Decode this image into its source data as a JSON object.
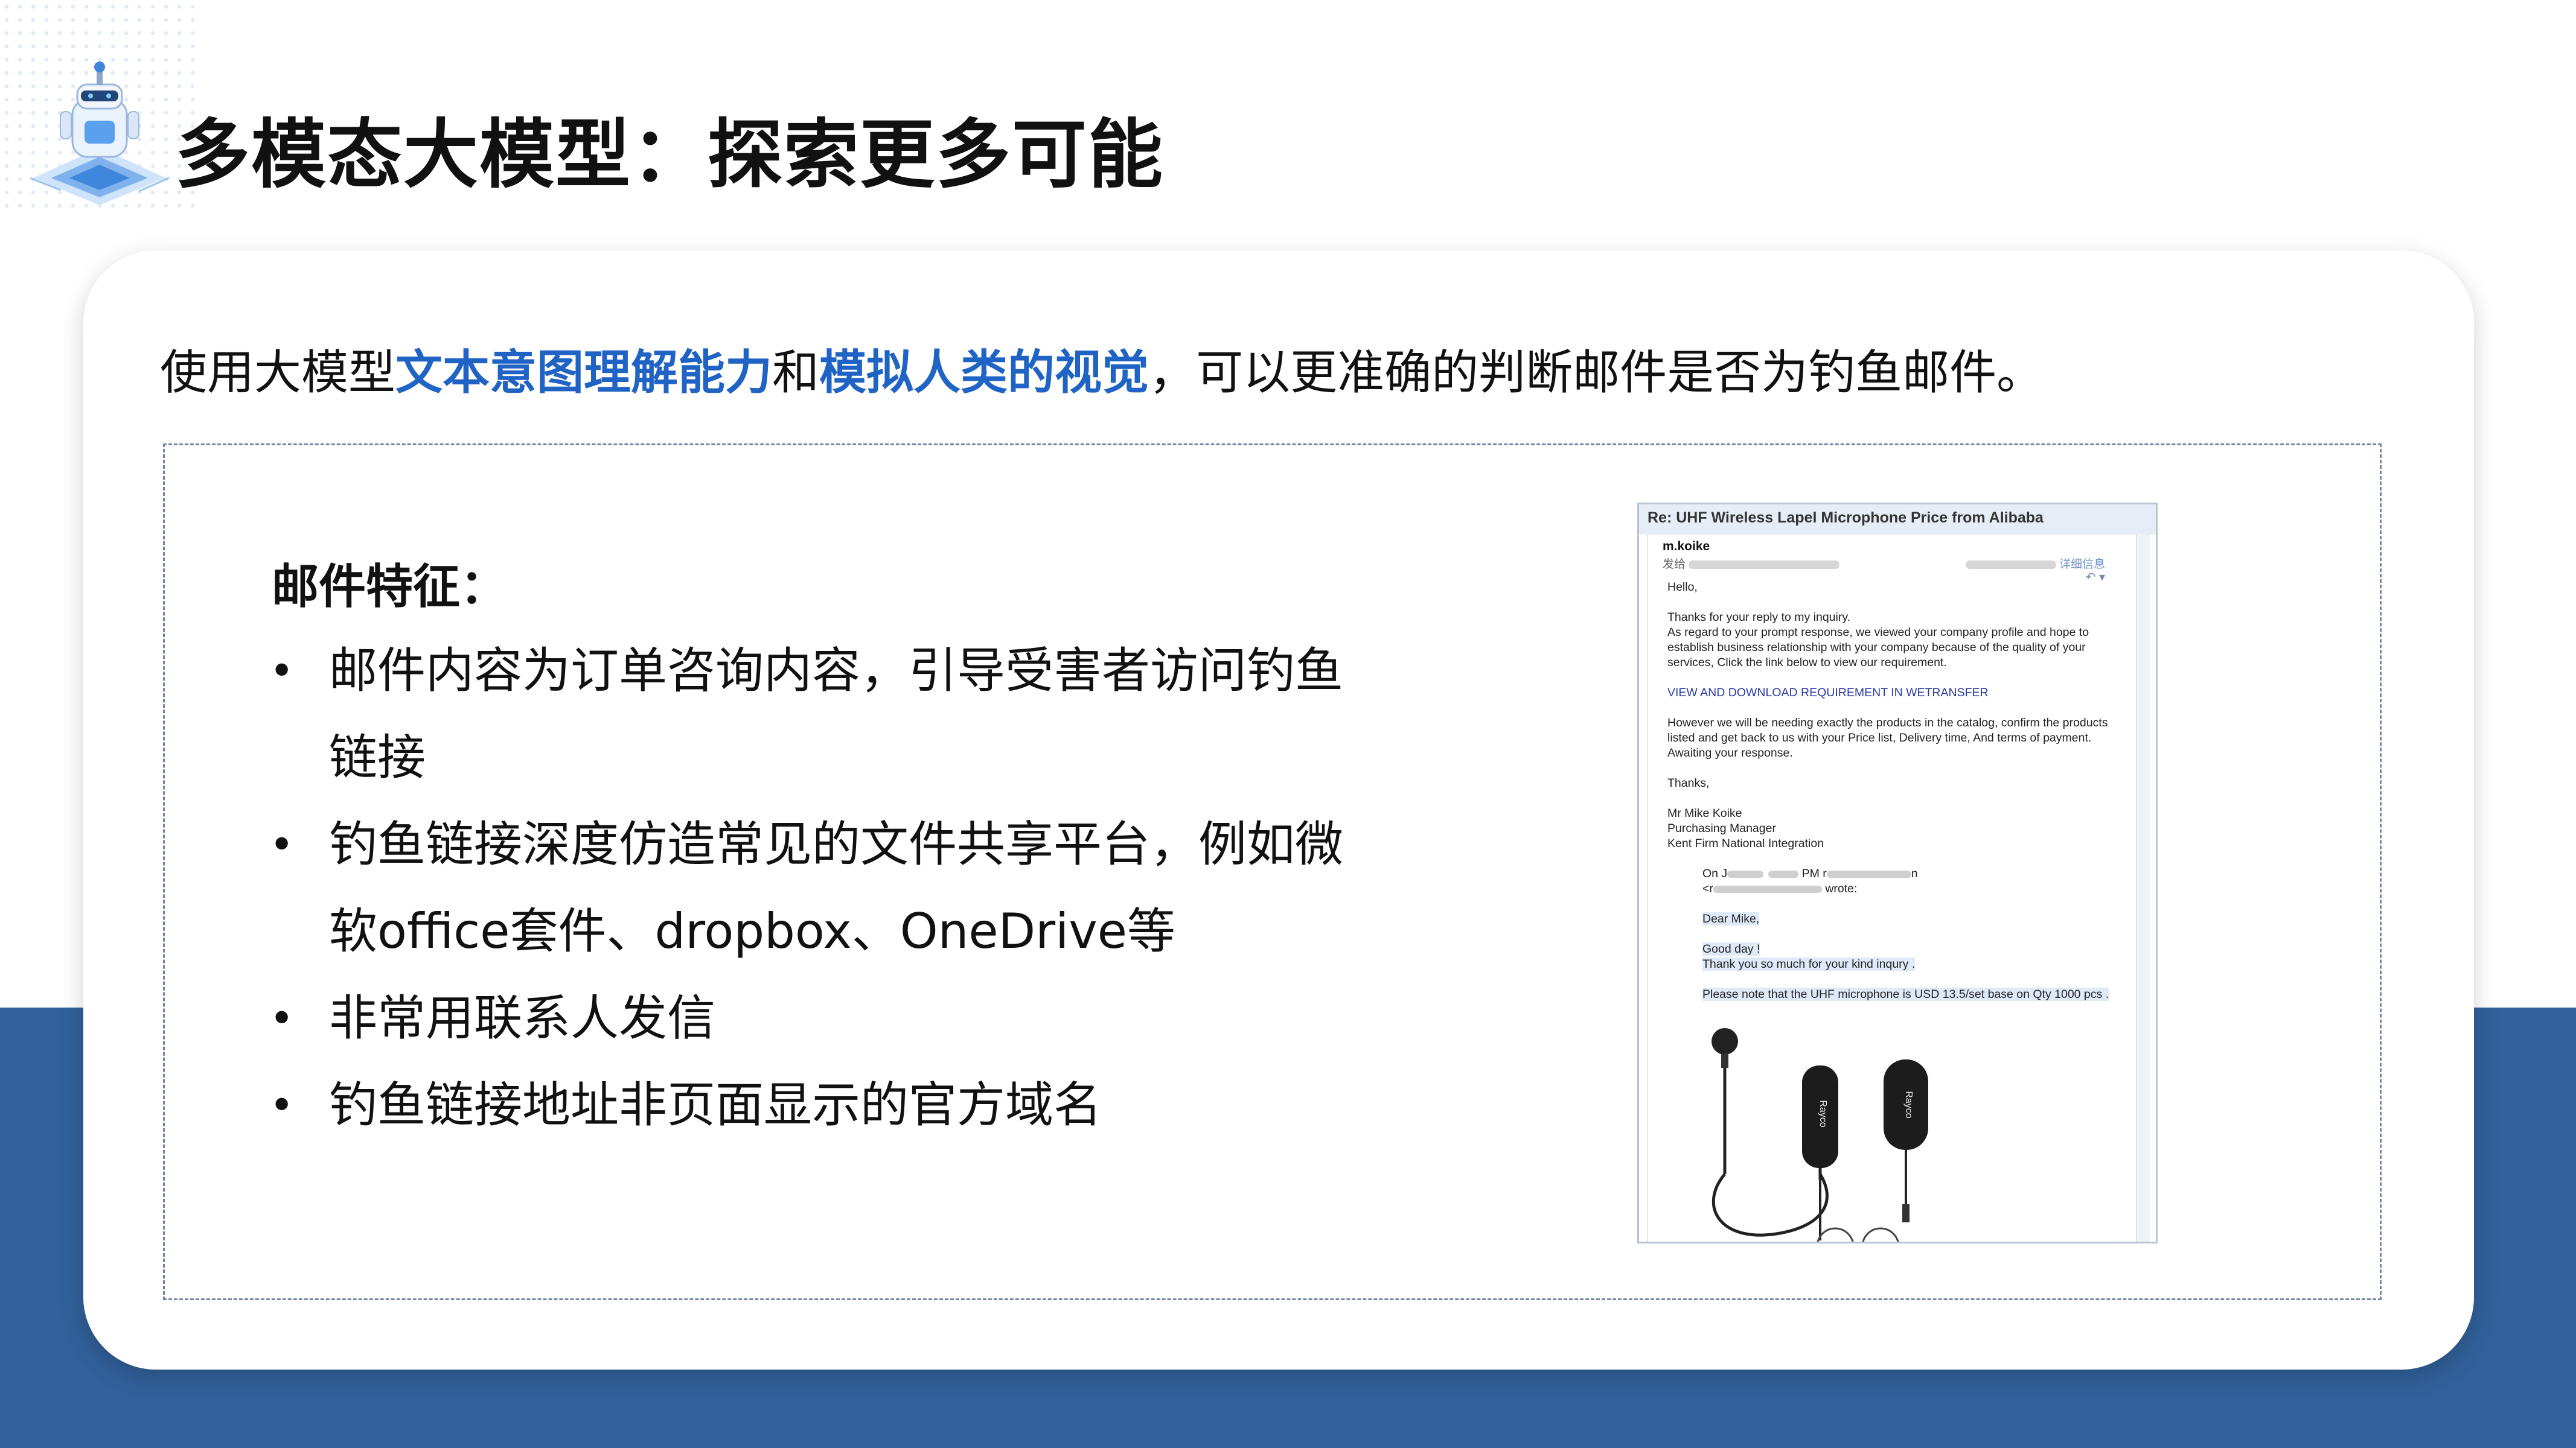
{
  "header": {
    "title": "多模态大模型：探索更多可能"
  },
  "intro": {
    "prefix": "使用大模型",
    "highlight1": "文本意图理解能力",
    "joiner": "和",
    "highlight2": "模拟人类的视觉",
    "suffix": "，可以更准确的判断邮件是否为钓鱼邮件。"
  },
  "features": {
    "title": "邮件特征：",
    "bullet_symbol": "•",
    "items": [
      "邮件内容为订单咨询内容，引导受害者访问钓鱼链接",
      "钓鱼链接深度仿造常见的文件共享平台，例如微软office套件、dropbox、OneDrive等",
      "非常用联系人发信",
      "钓鱼链接地址非页面显示的官方域名"
    ]
  },
  "email": {
    "subject": "Re: UHF Wireless Lapel Microphone Price from Alibaba",
    "sender": "m.koike",
    "to_label": "发给",
    "details_link": "详细信息",
    "greeting": "Hello,",
    "para1": "Thanks for your reply to my inquiry.",
    "para2": "As regard to your prompt response, we viewed your company profile and hope to establish business relationship with your company because of the quality of your services, Click the link below to view our requirement.",
    "link_text": "VIEW AND DOWNLOAD REQUIREMENT IN WETRANSFER",
    "para3": "However we will be needing exactly the products in the catalog, confirm the products listed and get back to us with your Price list, Delivery time, And terms of payment. Awaiting your response.",
    "thanks": "Thanks,",
    "sig_name": "Mr Mike Koike",
    "sig_title": "Purchasing Manager",
    "sig_company": "Kent Firm National Integration",
    "quote_on": "On J",
    "quote_pm": "PM r",
    "quote_n": "n",
    "quote_lt": "<r",
    "quote_wrote": "wrote:",
    "dear": "Dear Mike,",
    "good_day": "Good day !",
    "thank_you": "Thank you so much for your kind inqury .",
    "price_note": "Please note that the UHF microphone is USD 13.5/set base on Qty 1000 pcs .",
    "brand": "Rayco"
  },
  "colors": {
    "accent": "#1f63c4",
    "band": "#31609a"
  }
}
